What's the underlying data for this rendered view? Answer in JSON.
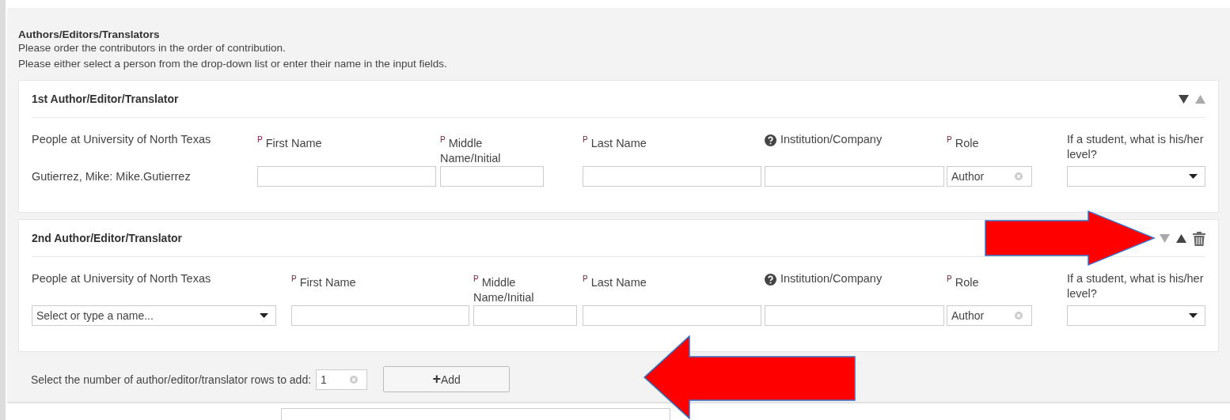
{
  "section": {
    "title": "Authors/Editors/Translators",
    "notes": [
      "Please order the contributors in the order of contribution.",
      "Please either select a person from the drop-down list or enter their name in the input fields."
    ]
  },
  "contributors": [
    {
      "title": "1st Author/Editor/Translator",
      "move_down_enabled": true,
      "move_up_enabled": false,
      "deletable": false,
      "fields": [
        {
          "kind": "static",
          "label": "People at University of North Texas",
          "value": "Gutierrez, Mike: Mike.Gutierrez"
        },
        {
          "kind": "input",
          "label": "First Name",
          "required_mark": "P"
        },
        {
          "kind": "input",
          "label": "Middle Name/Initial",
          "required_mark": "P"
        },
        {
          "kind": "input",
          "label": "Last Name",
          "required_mark": "P"
        },
        {
          "kind": "input",
          "label": "Institution/Company",
          "help": true
        },
        {
          "kind": "clearable",
          "label": "Role",
          "required_mark": "P",
          "value": "Author"
        },
        {
          "kind": "select",
          "label": "If a student, what is his/her level?"
        }
      ]
    },
    {
      "title": "2nd Author/Editor/Translator",
      "move_down_enabled": false,
      "move_up_enabled": true,
      "deletable": true,
      "fields": [
        {
          "kind": "select",
          "label": "People at University of North Texas",
          "placeholder": "Select or type a name..."
        },
        {
          "kind": "input",
          "label": "First Name",
          "required_mark": "P"
        },
        {
          "kind": "input",
          "label": "Middle Name/Initial",
          "required_mark": "P"
        },
        {
          "kind": "input",
          "label": "Last Name",
          "required_mark": "P"
        },
        {
          "kind": "input",
          "label": "Institution/Company",
          "help": true
        },
        {
          "kind": "clearable",
          "label": "Role",
          "required_mark": "P",
          "value": "Author"
        },
        {
          "kind": "select",
          "label": "If a student, what is his/her level?"
        }
      ]
    }
  ],
  "add_row": {
    "label": "Select the number of author/editor/translator rows to add:",
    "count": "1",
    "button": "Add",
    "button_icon": "+"
  }
}
